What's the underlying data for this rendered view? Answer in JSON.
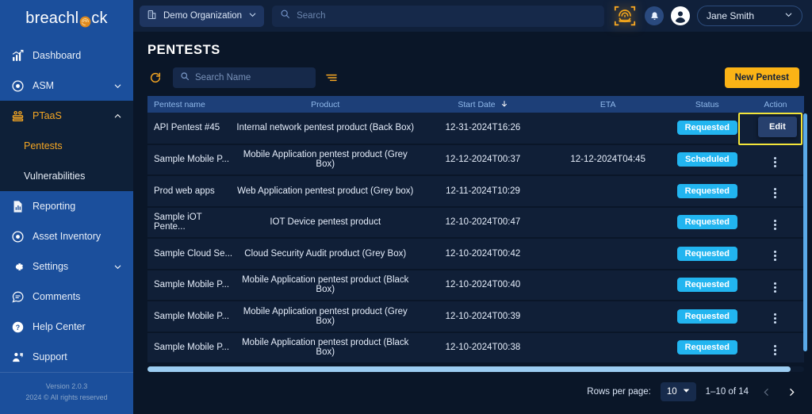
{
  "sidebar": {
    "logo": "breachl_ck",
    "logo_text_a": "breachl",
    "logo_text_b": "ck",
    "items": [
      {
        "label": "Dashboard",
        "icon": "chart-bar-icon",
        "expandable": false
      },
      {
        "label": "ASM",
        "icon": "target-icon",
        "expandable": true
      },
      {
        "label": "PTaaS",
        "icon": "group-icon",
        "expandable": true
      },
      {
        "label": "Reporting",
        "icon": "report-document-icon",
        "expandable": false
      },
      {
        "label": "Asset Inventory",
        "icon": "target-icon",
        "expandable": false
      },
      {
        "label": "Settings",
        "icon": "gear-icon",
        "expandable": true
      },
      {
        "label": "Comments",
        "icon": "chat-bubble-icon",
        "expandable": false
      },
      {
        "label": "Help Center",
        "icon": "question-circle-icon",
        "expandable": false
      },
      {
        "label": "Support",
        "icon": "support-agent-icon",
        "expandable": false
      }
    ],
    "ptaas_children": [
      {
        "label": "Pentests",
        "active": true
      },
      {
        "label": "Vulnerabilities",
        "active": false
      }
    ],
    "footer_version": "Version 2.0.3",
    "footer_copyright": "2024 © All rights reserved"
  },
  "topbar": {
    "org_name": "Demo Organization",
    "search_placeholder": "Search",
    "search_value": "",
    "user_name": "Jane Smith",
    "icons": [
      "fingerprint-icon",
      "bell-icon",
      "user-avatar-icon"
    ]
  },
  "page": {
    "title": "PENTESTS"
  },
  "toolbar": {
    "refresh_icon": "refresh-icon",
    "search_placeholder": "Search Name",
    "search_value": "",
    "filter_icon": "filter-icon",
    "new_pentest_label": "New Pentest"
  },
  "table": {
    "columns": [
      "Pentest name",
      "Product",
      "Start Date",
      "ETA",
      "Status",
      "Action"
    ],
    "sorted_column": "Start Date",
    "sort_direction": "desc",
    "rows": [
      {
        "name": "API Pentest #45",
        "product": "Internal network pentest product (Back Box)",
        "start_date": "12-31-2024T16:26",
        "eta": "",
        "status": "Requested"
      },
      {
        "name": "Sample Mobile P...",
        "product": "Mobile Application pentest product (Grey Box)",
        "start_date": "12-12-2024T00:37",
        "eta": "12-12-2024T04:45",
        "status": "Scheduled"
      },
      {
        "name": "Prod web apps",
        "product": "Web Application pentest product (Grey box)",
        "start_date": "12-11-2024T10:29",
        "eta": "",
        "status": "Requested"
      },
      {
        "name": "Sample iOT Pente...",
        "product": "IOT Device pentest product",
        "start_date": "12-10-2024T00:47",
        "eta": "",
        "status": "Requested"
      },
      {
        "name": "Sample Cloud Se...",
        "product": "Cloud Security Audit product (Grey Box)",
        "start_date": "12-10-2024T00:42",
        "eta": "",
        "status": "Requested"
      },
      {
        "name": "Sample Mobile P...",
        "product": "Mobile Application pentest product (Black Box)",
        "start_date": "12-10-2024T00:40",
        "eta": "",
        "status": "Requested"
      },
      {
        "name": "Sample Mobile P...",
        "product": "Mobile Application pentest product (Grey Box)",
        "start_date": "12-10-2024T00:39",
        "eta": "",
        "status": "Requested"
      },
      {
        "name": "Sample Mobile P...",
        "product": "Mobile Application pentest product (Black Box)",
        "start_date": "12-10-2024T00:38",
        "eta": "",
        "status": "Requested"
      }
    ],
    "row_action_icon": "vertical-dots-icon",
    "open_menu": {
      "label": "Edit",
      "row_index": 0
    }
  },
  "pagination": {
    "rows_per_page_label": "Rows per page:",
    "rows_per_page_value": "10",
    "range_label": "1–10 of 14",
    "prev_label": "‹",
    "next_label": "›"
  },
  "colors": {
    "sidebar_blue": "#1b4f9c",
    "accent_orange": "#f5a623",
    "button_yellow": "#fbb316",
    "badge_blue": "#22b5f0",
    "bg_dark": "#0a1628",
    "row_bg": "#101f37",
    "header_bg": "#1d3f78",
    "highlight_yellow": "#f3e53a"
  }
}
